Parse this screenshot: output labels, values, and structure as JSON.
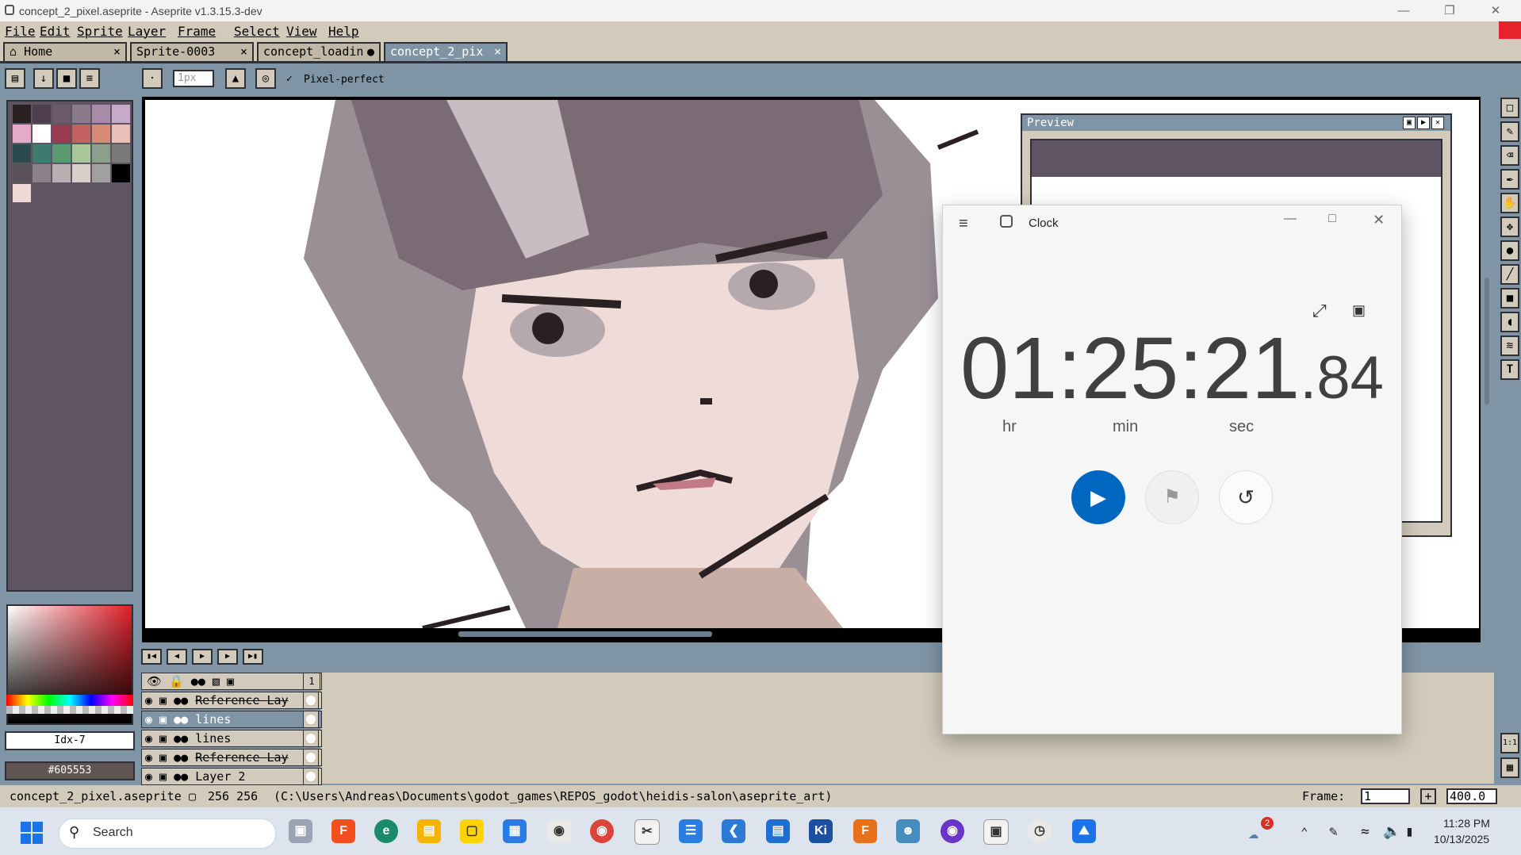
{
  "window": {
    "title": "concept_2_pixel.aseprite - Aseprite v1.3.15.3-dev"
  },
  "menu": [
    "File",
    "Edit",
    "Sprite",
    "Layer",
    "Frame",
    "Select",
    "View",
    "Help"
  ],
  "tabs": [
    {
      "label": "Home",
      "suffix": "×"
    },
    {
      "label": "Sprite-0003",
      "suffix": "×"
    },
    {
      "label": "concept_loadin",
      "suffix": "●"
    },
    {
      "label": "concept_2_pix",
      "suffix": "×"
    }
  ],
  "toolbar": {
    "brush_size": "1px",
    "pixel_perfect": "Pixel-perfect"
  },
  "palette": {
    "index_label": "Idx-7",
    "hex_label": "#605553",
    "colors": [
      "#2a2022",
      "#4e3e4b",
      "#6a5a6a",
      "#8a7a8c",
      "#a88ba8",
      "#c7a9c9",
      "#e6a9c9",
      "#ffffff",
      "#9a3a4f",
      "#c46060",
      "#d88a78",
      "#e8c0b8",
      "#2a4a50",
      "#3e7a6e",
      "#5a9a70",
      "#a8c89a",
      "#8aa08a",
      "#7a7a7a",
      "#5a5258",
      "#8a8288",
      "#b8b0b0",
      "#d8d0c8",
      "#a0a0a0",
      "#000000",
      "#f0d8d4"
    ]
  },
  "preview": {
    "title": "Preview"
  },
  "layers": [
    {
      "name": "Reference Lay",
      "struck": true,
      "selected": false
    },
    {
      "name": "lines",
      "struck": false,
      "selected": true
    },
    {
      "name": "lines",
      "struck": false,
      "selected": false
    },
    {
      "name": "Reference Lay",
      "struck": true,
      "selected": false
    },
    {
      "name": "Layer 2",
      "struck": false,
      "selected": false
    }
  ],
  "timeline": {
    "frame_number": "1"
  },
  "status": {
    "file": "concept_2_pixel.aseprite",
    "size": "256 256",
    "path": "(C:\\Users\\Andreas\\Documents\\godot_games\\REPOS_godot\\heidis-salon\\aseprite_art)",
    "frame_label": "Frame:",
    "frame_value": "1",
    "zoom": "400.0"
  },
  "clock": {
    "title": "Clock",
    "hours": "01",
    "minutes": "25",
    "seconds": "21",
    "hundredths": "84",
    "hr_label": "hr",
    "min_label": "min",
    "sec_label": "sec"
  },
  "taskbar": {
    "search": "Search",
    "time": "11:28 PM",
    "date": "10/13/2025",
    "weather_badge": "2"
  }
}
